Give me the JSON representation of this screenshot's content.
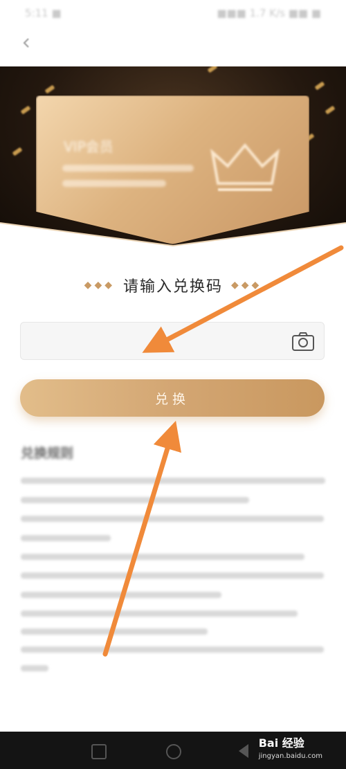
{
  "status_bar": {
    "left": "5:11 ■",
    "right": "■■■ 1.7 K/s ■■ ■"
  },
  "hero": {
    "card_title": "VIP会员"
  },
  "redeem": {
    "heading": "请输入兑换码",
    "dots": "◆◆◆",
    "input_value": "",
    "input_placeholder": "",
    "button_label": "兑换"
  },
  "rules": {
    "title": "兑换规则"
  },
  "watermark": {
    "brand": "Bai 经验",
    "domain": "jingyan.baidu.com"
  },
  "colors": {
    "accent_gold": "#d3a673",
    "arrow_orange": "#f08a3a",
    "hero_dark": "#24180f"
  },
  "icons": [
    "back-arrow-icon",
    "camera-icon",
    "crown-icon"
  ]
}
